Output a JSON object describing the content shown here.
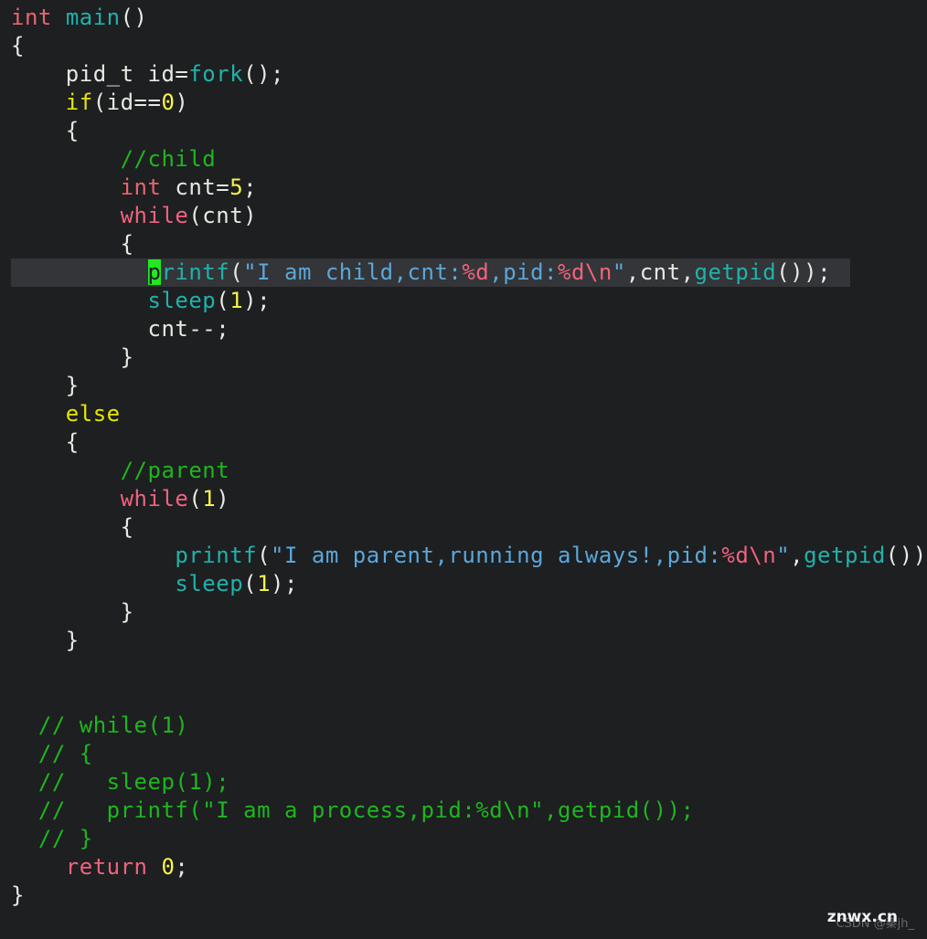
{
  "editor": {
    "theme": {
      "background": "#1d1f21",
      "foreground": "#e8e8e3",
      "current_line_highlight": "#333538",
      "cursor": "#22e822",
      "keyword_red": "#e8656f",
      "keyword_yellow": "#e6e600",
      "keyword_pink": "#f0627e",
      "function": "#20b2aa",
      "string": "#5ba7d9",
      "escape": "#f0627e",
      "number": "#f3f34a",
      "comment": "#1eb61e"
    },
    "language": "C",
    "cursor_character": "p",
    "cursor_line_index": 9,
    "lines": [
      {
        "indent": 0,
        "tokens": [
          {
            "t": "int",
            "c": "kw-red"
          },
          {
            "t": " ",
            "c": "plain"
          },
          {
            "t": "main",
            "c": "fn"
          },
          {
            "t": "()",
            "c": "plain"
          }
        ]
      },
      {
        "indent": 0,
        "tokens": [
          {
            "t": "{",
            "c": "plain"
          }
        ]
      },
      {
        "indent": 2,
        "tokens": [
          {
            "t": "pid_t id=",
            "c": "plain"
          },
          {
            "t": "fork",
            "c": "fn"
          },
          {
            "t": "();",
            "c": "plain"
          }
        ]
      },
      {
        "indent": 2,
        "tokens": [
          {
            "t": "if",
            "c": "kw-yellow"
          },
          {
            "t": "(id==",
            "c": "plain"
          },
          {
            "t": "0",
            "c": "num"
          },
          {
            "t": ")",
            "c": "plain"
          }
        ]
      },
      {
        "indent": 2,
        "tokens": [
          {
            "t": "{",
            "c": "plain"
          }
        ]
      },
      {
        "indent": 4,
        "tokens": [
          {
            "t": "//child",
            "c": "comment"
          }
        ]
      },
      {
        "indent": 4,
        "tokens": [
          {
            "t": "int",
            "c": "kw-red"
          },
          {
            "t": " cnt=",
            "c": "plain"
          },
          {
            "t": "5",
            "c": "num"
          },
          {
            "t": ";",
            "c": "plain"
          }
        ]
      },
      {
        "indent": 4,
        "tokens": [
          {
            "t": "while",
            "c": "kw-pink"
          },
          {
            "t": "(cnt)",
            "c": "plain"
          }
        ]
      },
      {
        "indent": 4,
        "tokens": [
          {
            "t": "{",
            "c": "plain"
          }
        ]
      },
      {
        "indent": 5,
        "highlight": true,
        "tokens": [
          {
            "t": "p",
            "c": "cursor"
          },
          {
            "t": "rintf",
            "c": "fn"
          },
          {
            "t": "(",
            "c": "plain"
          },
          {
            "t": "\"I am child,cnt:",
            "c": "str"
          },
          {
            "t": "%d",
            "c": "esc"
          },
          {
            "t": ",pid:",
            "c": "str"
          },
          {
            "t": "%d",
            "c": "esc"
          },
          {
            "t": "\\n",
            "c": "esc"
          },
          {
            "t": "\"",
            "c": "str"
          },
          {
            "t": ",cnt,",
            "c": "plain"
          },
          {
            "t": "getpid",
            "c": "fn"
          },
          {
            "t": "());",
            "c": "plain"
          }
        ]
      },
      {
        "indent": 5,
        "tokens": [
          {
            "t": "sleep",
            "c": "fn"
          },
          {
            "t": "(",
            "c": "plain"
          },
          {
            "t": "1",
            "c": "num"
          },
          {
            "t": ");",
            "c": "plain"
          }
        ]
      },
      {
        "indent": 5,
        "tokens": [
          {
            "t": "cnt--;",
            "c": "plain"
          }
        ]
      },
      {
        "indent": 4,
        "tokens": [
          {
            "t": "}",
            "c": "plain"
          }
        ]
      },
      {
        "indent": 2,
        "tokens": [
          {
            "t": "}",
            "c": "plain"
          }
        ]
      },
      {
        "indent": 2,
        "tokens": [
          {
            "t": "else",
            "c": "kw-yellow"
          }
        ]
      },
      {
        "indent": 2,
        "tokens": [
          {
            "t": "{",
            "c": "plain"
          }
        ]
      },
      {
        "indent": 4,
        "tokens": [
          {
            "t": "//parent",
            "c": "comment"
          }
        ]
      },
      {
        "indent": 4,
        "tokens": [
          {
            "t": "while",
            "c": "kw-pink"
          },
          {
            "t": "(",
            "c": "plain"
          },
          {
            "t": "1",
            "c": "num"
          },
          {
            "t": ")",
            "c": "plain"
          }
        ]
      },
      {
        "indent": 4,
        "tokens": [
          {
            "t": "{",
            "c": "plain"
          }
        ]
      },
      {
        "indent": 6,
        "tokens": [
          {
            "t": "printf",
            "c": "fn"
          },
          {
            "t": "(",
            "c": "plain"
          },
          {
            "t": "\"I am parent,running always!,pid:",
            "c": "str"
          },
          {
            "t": "%d",
            "c": "esc"
          },
          {
            "t": "\\n",
            "c": "esc"
          },
          {
            "t": "\"",
            "c": "str"
          },
          {
            "t": ",",
            "c": "plain"
          },
          {
            "t": "getpid",
            "c": "fn"
          },
          {
            "t": "());",
            "c": "plain"
          }
        ]
      },
      {
        "indent": 6,
        "tokens": [
          {
            "t": "sleep",
            "c": "fn"
          },
          {
            "t": "(",
            "c": "plain"
          },
          {
            "t": "1",
            "c": "num"
          },
          {
            "t": ");",
            "c": "plain"
          }
        ]
      },
      {
        "indent": 4,
        "tokens": [
          {
            "t": "}",
            "c": "plain"
          }
        ]
      },
      {
        "indent": 2,
        "tokens": [
          {
            "t": "}",
            "c": "plain"
          }
        ]
      },
      {
        "indent": 0,
        "tokens": []
      },
      {
        "indent": 0,
        "tokens": []
      },
      {
        "indent": 1,
        "tokens": [
          {
            "t": "// while(1)",
            "c": "comment"
          }
        ]
      },
      {
        "indent": 1,
        "tokens": [
          {
            "t": "// {",
            "c": "comment"
          }
        ]
      },
      {
        "indent": 1,
        "tokens": [
          {
            "t": "//   sleep(1);",
            "c": "comment"
          }
        ]
      },
      {
        "indent": 1,
        "tokens": [
          {
            "t": "//   printf(\"I am a process,pid:%d\\n\",getpid());",
            "c": "comment"
          }
        ]
      },
      {
        "indent": 1,
        "tokens": [
          {
            "t": "// }",
            "c": "comment"
          }
        ]
      },
      {
        "indent": 2,
        "tokens": [
          {
            "t": "return",
            "c": "kw-pink"
          },
          {
            "t": " ",
            "c": "plain"
          },
          {
            "t": "0",
            "c": "num"
          },
          {
            "t": ";",
            "c": "plain"
          }
        ]
      },
      {
        "indent": 0,
        "tokens": [
          {
            "t": "}",
            "c": "plain"
          }
        ]
      }
    ]
  },
  "watermark": {
    "primary": "znwx.cn",
    "secondary": "CSDN @秦jh_"
  }
}
